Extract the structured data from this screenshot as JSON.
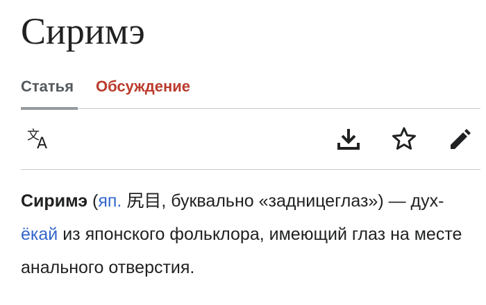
{
  "article": {
    "title": "Сиримэ"
  },
  "tabs": {
    "article_label": "Статья",
    "talk_label": "Обсуждение"
  },
  "toolbar": {
    "icons": [
      "language-icon",
      "download-icon",
      "star-icon",
      "edit-icon"
    ]
  },
  "colors": {
    "text": "#202122",
    "link": "#3366cc",
    "talk_tab": "#ba3b2c",
    "active_tab": "#54595d",
    "divider": "#c8ccd1"
  },
  "content": {
    "term": "Сиримэ",
    "open_paren": " (",
    "lang_abbr": "яп.",
    "space1": " ",
    "japanese": "尻目",
    "literal": ", буквально «задницеглаз») — дух-",
    "yokai_link": "ёкай",
    "rest": " из японского фольклора, имеющий глаз на месте анального отверстия."
  }
}
